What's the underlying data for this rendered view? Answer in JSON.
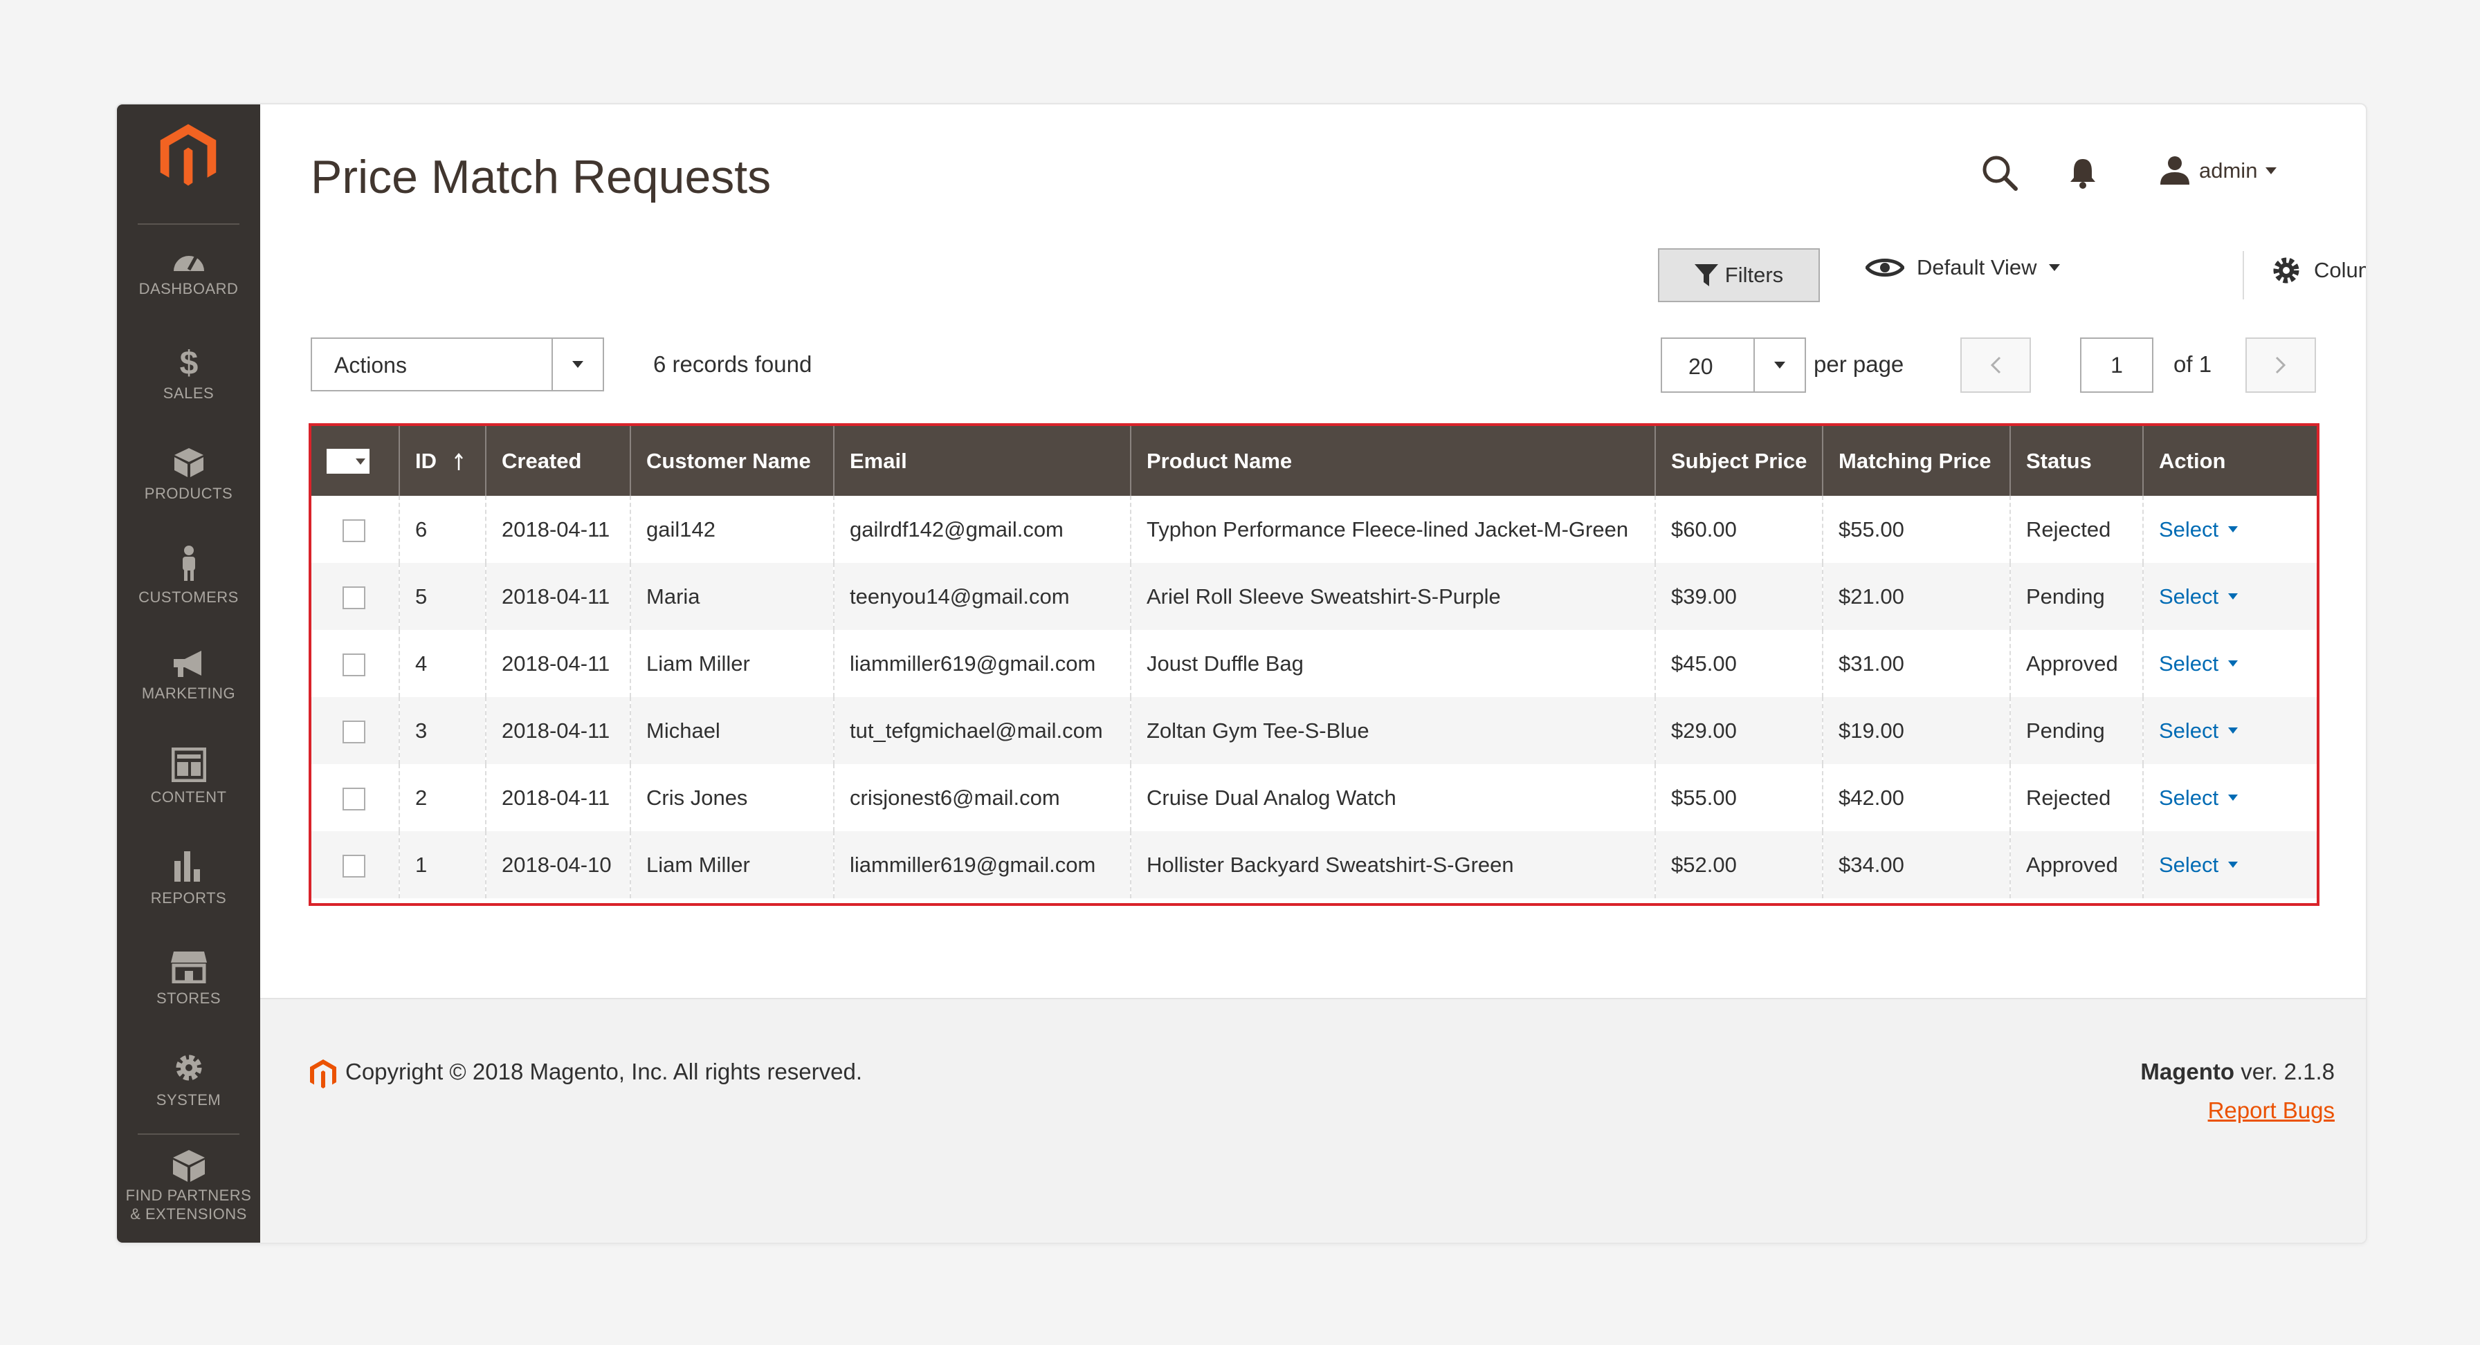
{
  "sidebar": {
    "items": [
      {
        "label": "DASHBOARD",
        "icon": "dashboard-icon"
      },
      {
        "label": "SALES",
        "icon": "dollar-icon"
      },
      {
        "label": "PRODUCTS",
        "icon": "box-icon"
      },
      {
        "label": "CUSTOMERS",
        "icon": "person-icon"
      },
      {
        "label": "MARKETING",
        "icon": "megaphone-icon"
      },
      {
        "label": "CONTENT",
        "icon": "layout-icon"
      },
      {
        "label": "REPORTS",
        "icon": "bar-chart-icon"
      },
      {
        "label": "STORES",
        "icon": "store-icon"
      },
      {
        "label": "SYSTEM",
        "icon": "gear-icon"
      },
      {
        "label": "FIND PARTNERS",
        "label2": "& EXTENSIONS",
        "icon": "cube-icon"
      }
    ]
  },
  "header": {
    "title": "Price Match Requests",
    "user": "admin"
  },
  "toolbar": {
    "filters_label": "Filters",
    "view_label": "Default View",
    "columns_label": "Columns",
    "actions_label": "Actions",
    "records_found": "6 records found",
    "per_page_value": "20",
    "per_page_label": "per page",
    "page_value": "1",
    "page_of": "of 1"
  },
  "grid": {
    "headers": {
      "id": "ID",
      "created": "Created",
      "customer": "Customer Name",
      "email": "Email",
      "product": "Product Name",
      "subject_price": "Subject Price",
      "matching_price": "Matching Price",
      "status": "Status",
      "action": "Action"
    },
    "rows": [
      {
        "id": "6",
        "created": "2018-04-11",
        "customer": "gail142",
        "email": "gailrdf142@gmail.com",
        "product": "Typhon Performance Fleece-lined Jacket-M-Green",
        "subject_price": "$60.00",
        "matching_price": "$55.00",
        "status": "Rejected",
        "action": "Select"
      },
      {
        "id": "5",
        "created": "2018-04-11",
        "customer": "Maria",
        "email": "teenyou14@gmail.com",
        "product": "Ariel Roll Sleeve Sweatshirt-S-Purple",
        "subject_price": "$39.00",
        "matching_price": "$21.00",
        "status": "Pending",
        "action": "Select"
      },
      {
        "id": "4",
        "created": "2018-04-11",
        "customer": "Liam Miller",
        "email": "liammiller619@gmail.com",
        "product": "Joust Duffle Bag",
        "subject_price": "$45.00",
        "matching_price": "$31.00",
        "status": "Approved",
        "action": "Select"
      },
      {
        "id": "3",
        "created": "2018-04-11",
        "customer": "Michael",
        "email": "tut_tefgmichael@mail.com",
        "product": "Zoltan Gym Tee-S-Blue",
        "subject_price": "$29.00",
        "matching_price": "$19.00",
        "status": "Pending",
        "action": "Select"
      },
      {
        "id": "2",
        "created": "2018-04-11",
        "customer": "Cris Jones",
        "email": "crisjonest6@mail.com",
        "product": "Cruise Dual Analog Watch",
        "subject_price": "$55.00",
        "matching_price": "$42.00",
        "status": "Rejected",
        "action": "Select"
      },
      {
        "id": "1",
        "created": "2018-04-10",
        "customer": "Liam Miller",
        "email": "liammiller619@gmail.com",
        "product": "Hollister Backyard Sweatshirt-S-Green",
        "subject_price": "$52.00",
        "matching_price": "$34.00",
        "status": "Approved",
        "action": "Select"
      }
    ]
  },
  "footer": {
    "copyright": "Copyright © 2018 Magento, Inc. All rights reserved.",
    "brand": "Magento",
    "version": "ver. 2.1.8",
    "report_bugs": "Report Bugs"
  },
  "colors": {
    "sidebar_bg": "#373330",
    "header_bg": "#514943",
    "accent": "#eb5202",
    "highlight_border": "#d9232a",
    "link": "#006bb4"
  }
}
